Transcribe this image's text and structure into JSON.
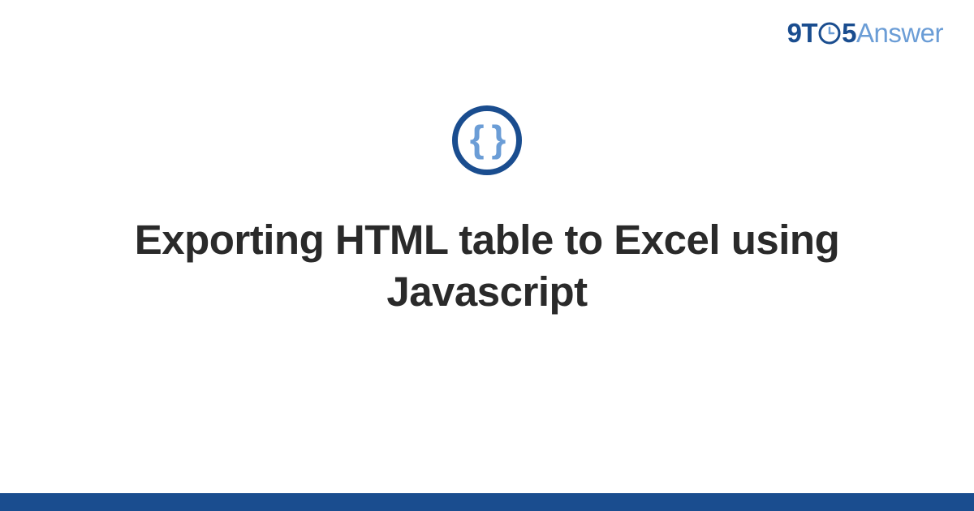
{
  "logo": {
    "part1": "9T",
    "part2": "5",
    "part3": "Answer"
  },
  "icon": {
    "braces": "{ }"
  },
  "title": "Exporting HTML table to Excel using Javascript",
  "colors": {
    "primary": "#1a4d8f",
    "secondary": "#6b9dd6"
  }
}
